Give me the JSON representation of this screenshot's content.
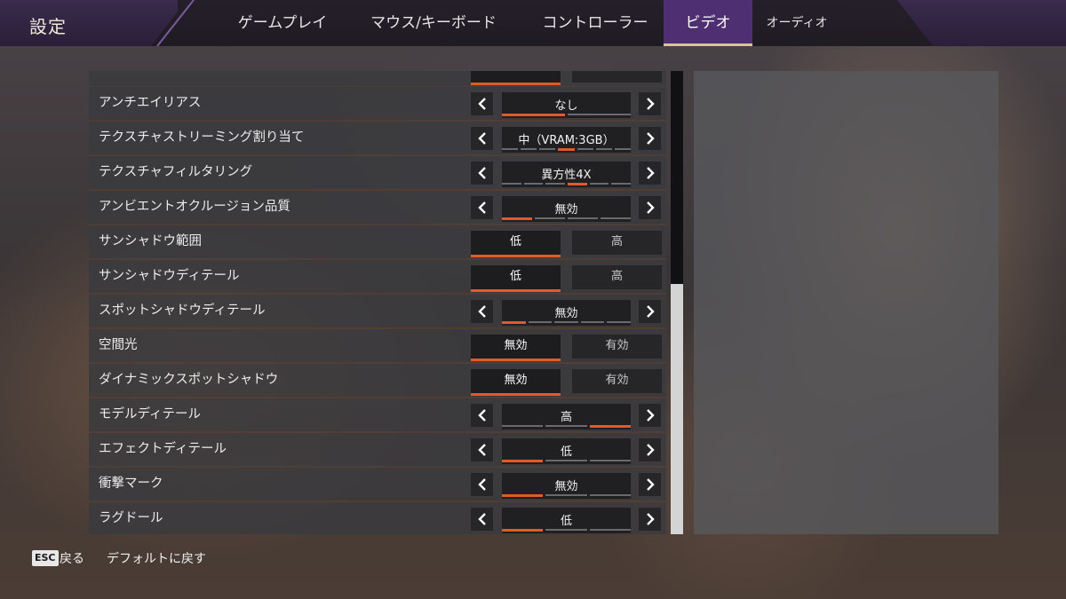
{
  "header": {
    "title": "設定",
    "tabs": [
      {
        "label": "ゲームプレイ",
        "active": false
      },
      {
        "label": "マウス/キーボード",
        "active": false
      },
      {
        "label": "コントローラー",
        "active": false
      },
      {
        "label": "ビデオ",
        "active": true
      },
      {
        "label": "オーディオ",
        "active": false
      }
    ]
  },
  "settings": [
    {
      "label": "",
      "type": "toggle",
      "options": [
        "",
        ""
      ],
      "selected": 0
    },
    {
      "label": "アンチエイリアス",
      "type": "selector",
      "value": "なし",
      "segments": 2,
      "active_segment": 1
    },
    {
      "label": "テクスチャストリーミング割り当て",
      "type": "selector",
      "value": "中（VRAM:3GB）",
      "segments": 7,
      "active_segment": 4
    },
    {
      "label": "テクスチャフィルタリング",
      "type": "selector",
      "value": "異方性4X",
      "segments": 6,
      "active_segment": 4
    },
    {
      "label": "アンビエントオクルージョン品質",
      "type": "selector",
      "value": "無効",
      "segments": 4,
      "active_segment": 1
    },
    {
      "label": "サンシャドウ範囲",
      "type": "toggle",
      "options": [
        "低",
        "高"
      ],
      "selected": 0
    },
    {
      "label": "サンシャドウディテール",
      "type": "toggle",
      "options": [
        "低",
        "高"
      ],
      "selected": 0
    },
    {
      "label": "スポットシャドウディテール",
      "type": "selector",
      "value": "無効",
      "segments": 5,
      "active_segment": 1
    },
    {
      "label": "空間光",
      "type": "toggle",
      "options": [
        "無効",
        "有効"
      ],
      "selected": 0
    },
    {
      "label": "ダイナミックスポットシャドウ",
      "type": "toggle",
      "options": [
        "無効",
        "有効"
      ],
      "selected": 0
    },
    {
      "label": "モデルディテール",
      "type": "selector",
      "value": "高",
      "segments": 3,
      "active_segment": 3
    },
    {
      "label": "エフェクトディテール",
      "type": "selector",
      "value": "低",
      "segments": 3,
      "active_segment": 1
    },
    {
      "label": "衝撃マーク",
      "type": "selector",
      "value": "無効",
      "segments": 3,
      "active_segment": 1
    },
    {
      "label": "ラグドール",
      "type": "selector",
      "value": "低",
      "segments": 3,
      "active_segment": 1
    }
  ],
  "footer": {
    "esc_key": "ESC",
    "back_label": "戻る",
    "default_label": "デフォルトに戻す"
  },
  "colors": {
    "accent": "#e2592a",
    "tab_active_bg": "#4e2f72",
    "tab_underline": "#d8c49c"
  },
  "icons": {
    "prev": "chevron-left-icon",
    "next": "chevron-right-icon"
  }
}
